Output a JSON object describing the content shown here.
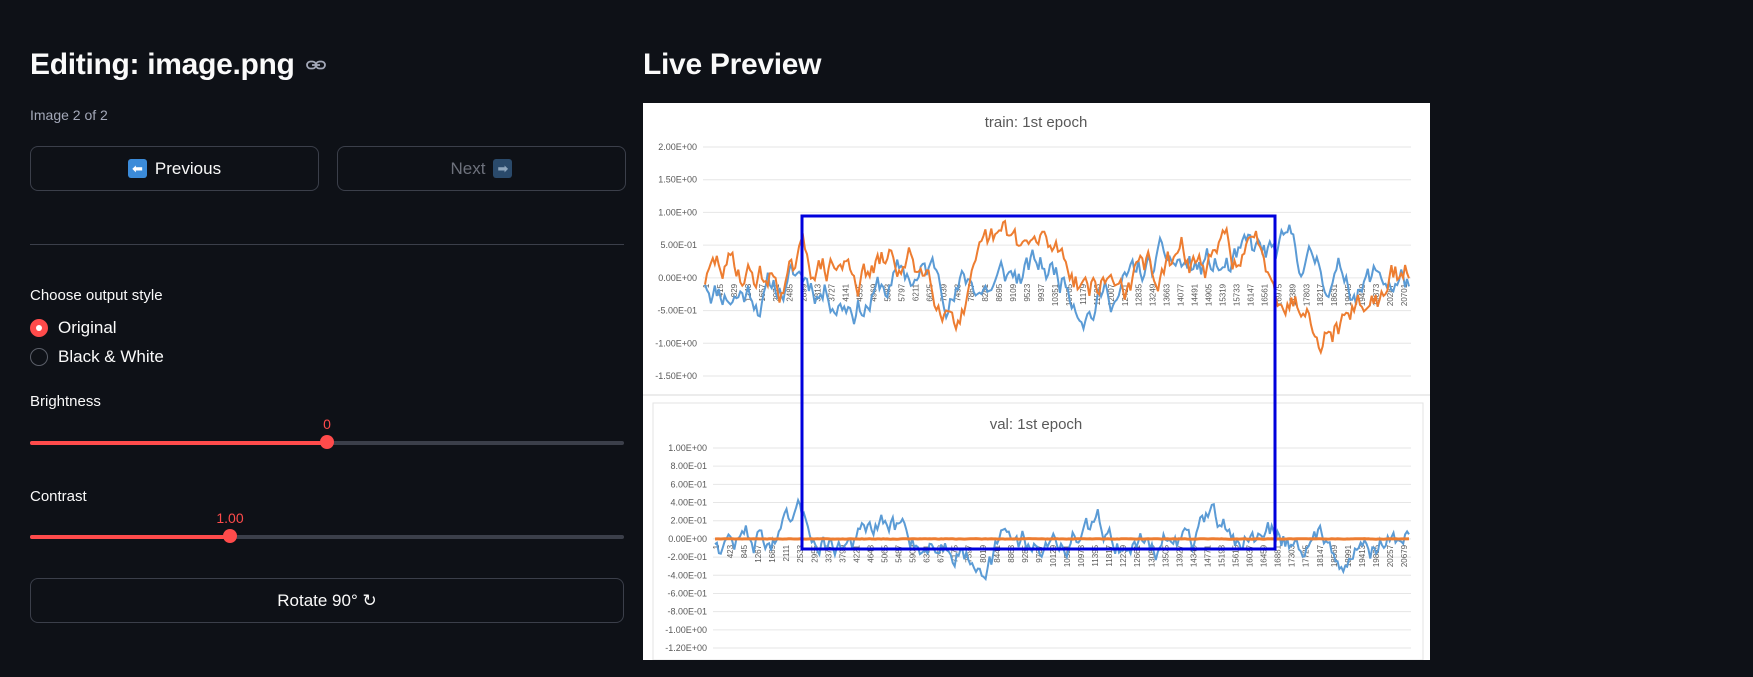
{
  "editor": {
    "title": "Editing: image.png",
    "image_counter": "Image 2 of 2",
    "previous_label": "Previous",
    "next_label": "Next",
    "previous_arrow": "⬅",
    "next_arrow": "➡",
    "next_disabled": true
  },
  "output_style": {
    "label": "Choose output style",
    "options": [
      "Original",
      "Black & White"
    ],
    "selected": "Original"
  },
  "brightness": {
    "label": "Brightness",
    "value": "0",
    "fraction": 0.5
  },
  "contrast": {
    "label": "Contrast",
    "value": "1.00",
    "fraction": 0.337
  },
  "rotate_label": "Rotate 90° ↻",
  "preview": {
    "title": "Live Preview",
    "highlight_color": "#0000dd",
    "series_colors": {
      "blue": "#5b9bd5",
      "orange": "#ed7d31"
    },
    "charts": [
      {
        "title": "train: 1st epoch",
        "y_ticks": [
          "2.00E+00",
          "1.50E+00",
          "1.00E+00",
          "5.00E-01",
          "0.00E+00",
          "-5.00E-01",
          "-1.00E+00",
          "-1.50E+00"
        ],
        "x_ticks": [
          "1",
          "415",
          "829",
          "1243",
          "1657",
          "2071",
          "2485",
          "2899",
          "3313",
          "3727",
          "4141",
          "4555",
          "4969",
          "5383",
          "5797",
          "6211",
          "6625",
          "7039",
          "7453",
          "7867",
          "8281",
          "8695",
          "9109",
          "9523",
          "9937",
          "10351",
          "10765",
          "11179",
          "11593",
          "12007",
          "12421",
          "12835",
          "13249",
          "13663",
          "14077",
          "14491",
          "14905",
          "15319",
          "15733",
          "16147",
          "16561",
          "16975",
          "17389",
          "17803",
          "18217",
          "18631",
          "19045",
          "19459",
          "19873",
          "20287",
          "20701"
        ]
      },
      {
        "title": "val: 1st epoch",
        "y_ticks": [
          "1.00E+00",
          "8.00E-01",
          "6.00E-01",
          "4.00E-01",
          "2.00E-01",
          "0.00E+00",
          "-2.00E-01",
          "-4.00E-01",
          "-6.00E-01",
          "-8.00E-01",
          "-1.00E+00",
          "-1.20E+00"
        ],
        "x_ticks": [
          "1",
          "423",
          "845",
          "1267",
          "1689",
          "2111",
          "2533",
          "2955",
          "3377",
          "3799",
          "4221",
          "4643",
          "5065",
          "5487",
          "5909",
          "6331",
          "6753",
          "7175",
          "7597",
          "8019",
          "8441",
          "8863",
          "9285",
          "9707",
          "10129",
          "10551",
          "10973",
          "11395",
          "11817",
          "12239",
          "12661",
          "13083",
          "13505",
          "13927",
          "14349",
          "14771",
          "15193",
          "15615",
          "16037",
          "16459",
          "16881",
          "17303",
          "17725",
          "18147",
          "18569",
          "18991",
          "19413",
          "19835",
          "20257",
          "20679"
        ]
      }
    ]
  }
}
